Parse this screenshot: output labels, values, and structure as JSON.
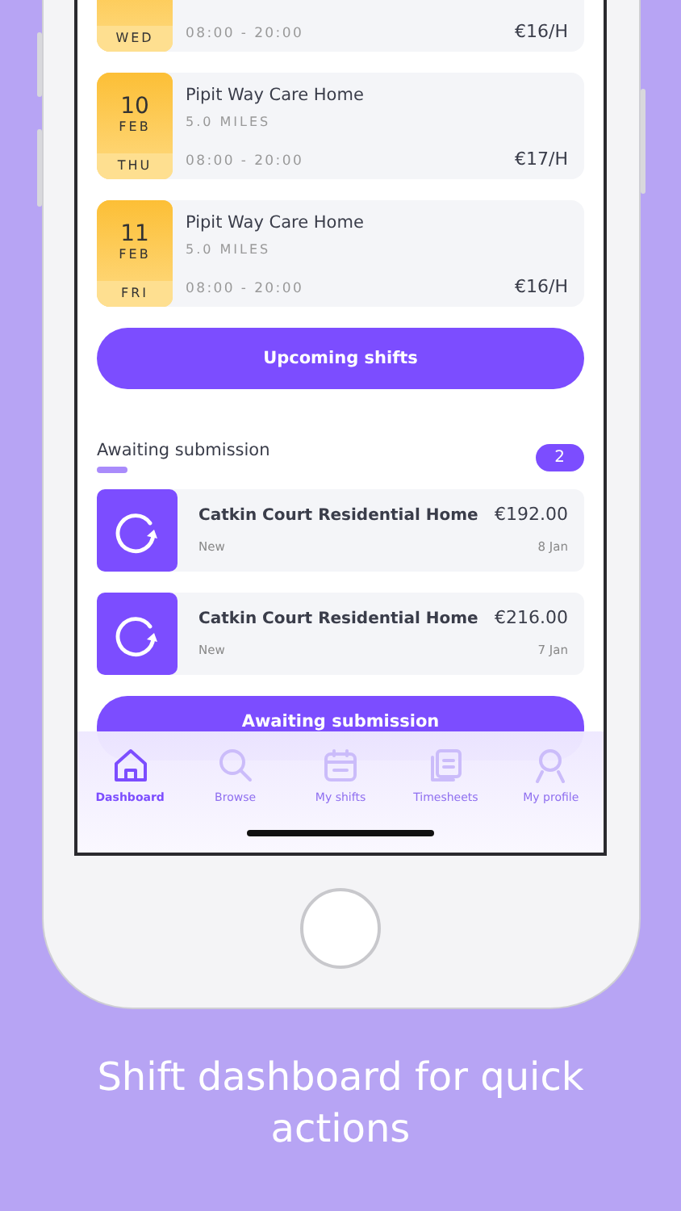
{
  "shifts": [
    {
      "weekday": "WED",
      "hours": "08:00 - 20:00",
      "rate": "€16/H"
    },
    {
      "day_number": "10",
      "month": "FEB",
      "weekday": "THU",
      "home": "Pipit Way Care Home",
      "distance": "5.0 MILES",
      "hours": "08:00 - 20:00",
      "rate": "€17/H"
    },
    {
      "day_number": "11",
      "month": "FEB",
      "weekday": "FRI",
      "home": "Pipit Way Care Home",
      "distance": "5.0 MILES",
      "hours": "08:00 - 20:00",
      "rate": "€16/H"
    }
  ],
  "upcoming_button": "Upcoming shifts",
  "awaiting": {
    "title": "Awaiting submission",
    "count": "2",
    "items": [
      {
        "home": "Catkin Court Residential Home",
        "amount": "€192.00",
        "status": "New",
        "date": "8 Jan"
      },
      {
        "home": "Catkin Court Residential Home",
        "amount": "€216.00",
        "status": "New",
        "date": "7 Jan"
      }
    ],
    "button": "Awaiting submission"
  },
  "tabs": [
    {
      "label": "Dashboard",
      "selected": true
    },
    {
      "label": "Browse",
      "selected": false
    },
    {
      "label": "My shifts",
      "selected": false
    },
    {
      "label": "Timesheets",
      "selected": false
    },
    {
      "label": "My profile",
      "selected": false
    }
  ],
  "caption": "Shift dashboard for quick actions"
}
